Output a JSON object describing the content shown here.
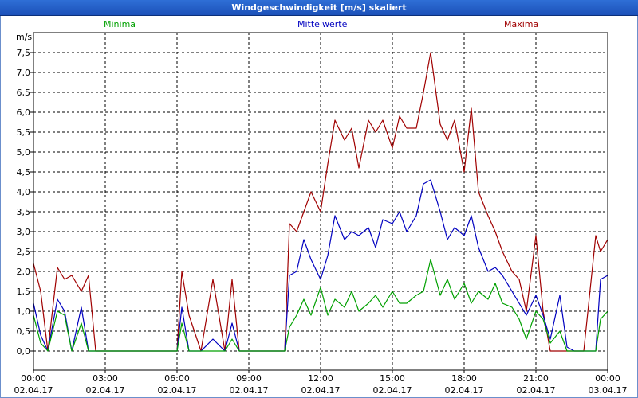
{
  "chart_data": {
    "type": "line",
    "title": "Windgeschwindigkeit [m/s] skaliert",
    "ylabel": "m/s",
    "ylim": [
      0,
      8
    ],
    "yticks": [
      "0,0",
      "0,5",
      "1,0",
      "1,5",
      "2,0",
      "2,5",
      "3,0",
      "3,5",
      "4,0",
      "4,5",
      "5,0",
      "5,5",
      "6,0",
      "6,5",
      "7,0",
      "7,5"
    ],
    "xlim": [
      0,
      24
    ],
    "xticks": [
      {
        "time": "00:00",
        "date": "02.04.17"
      },
      {
        "time": "03:00",
        "date": "02.04.17"
      },
      {
        "time": "06:00",
        "date": "02.04.17"
      },
      {
        "time": "09:00",
        "date": "02.04.17"
      },
      {
        "time": "12:00",
        "date": "02.04.17"
      },
      {
        "time": "15:00",
        "date": "02.04.17"
      },
      {
        "time": "18:00",
        "date": "02.04.17"
      },
      {
        "time": "21:00",
        "date": "02.04.17"
      },
      {
        "time": "00:00",
        "date": "03.04.17"
      }
    ],
    "grid": true,
    "series": [
      {
        "name": "Minima",
        "color": "#00a000",
        "x": [
          0.0,
          0.3,
          0.6,
          1.0,
          1.3,
          1.6,
          2.0,
          2.3,
          2.6,
          3.0,
          6.0,
          6.2,
          6.5,
          7.0,
          7.5,
          8.0,
          8.3,
          8.6,
          9.0,
          10.5,
          10.7,
          11.0,
          11.3,
          11.6,
          12.0,
          12.3,
          12.6,
          13.0,
          13.3,
          13.6,
          14.0,
          14.3,
          14.6,
          15.0,
          15.3,
          15.6,
          16.0,
          16.3,
          16.6,
          17.0,
          17.3,
          17.6,
          18.0,
          18.3,
          18.6,
          19.0,
          19.3,
          19.6,
          20.0,
          20.3,
          20.6,
          21.0,
          21.3,
          21.6,
          22.0,
          22.3,
          22.6,
          23.0,
          23.5,
          23.7,
          24.0
        ],
        "y": [
          0.9,
          0.2,
          0.0,
          1.0,
          0.9,
          0.0,
          0.7,
          0.0,
          0.0,
          0.0,
          0.0,
          0.7,
          0.0,
          0.0,
          0.0,
          0.0,
          0.3,
          0.0,
          0.0,
          0.0,
          0.6,
          0.9,
          1.3,
          0.9,
          1.6,
          0.9,
          1.3,
          1.1,
          1.5,
          1.0,
          1.2,
          1.4,
          1.1,
          1.5,
          1.2,
          1.2,
          1.4,
          1.5,
          2.3,
          1.4,
          1.8,
          1.3,
          1.7,
          1.2,
          1.5,
          1.3,
          1.7,
          1.2,
          1.1,
          0.8,
          0.3,
          1.0,
          0.8,
          0.2,
          0.5,
          0.0,
          0.0,
          0.0,
          0.0,
          0.8,
          1.0
        ]
      },
      {
        "name": "Mittelwerte",
        "color": "#0000c0",
        "x": [
          0.0,
          0.3,
          0.6,
          1.0,
          1.3,
          1.6,
          2.0,
          2.3,
          2.6,
          3.0,
          6.0,
          6.2,
          6.5,
          7.0,
          7.5,
          8.0,
          8.3,
          8.6,
          9.0,
          10.5,
          10.7,
          11.0,
          11.3,
          11.6,
          12.0,
          12.3,
          12.6,
          13.0,
          13.3,
          13.6,
          14.0,
          14.3,
          14.6,
          15.0,
          15.3,
          15.6,
          16.0,
          16.3,
          16.6,
          17.0,
          17.3,
          17.6,
          18.0,
          18.3,
          18.6,
          19.0,
          19.3,
          19.6,
          20.0,
          20.3,
          20.6,
          21.0,
          21.3,
          21.6,
          22.0,
          22.3,
          22.6,
          23.0,
          23.5,
          23.7,
          24.0
        ],
        "y": [
          1.2,
          0.4,
          0.0,
          1.3,
          1.0,
          0.0,
          1.1,
          0.0,
          0.0,
          0.0,
          0.0,
          1.1,
          0.0,
          0.0,
          0.3,
          0.0,
          0.7,
          0.0,
          0.0,
          0.0,
          1.9,
          2.0,
          2.8,
          2.3,
          1.8,
          2.4,
          3.4,
          2.8,
          3.0,
          2.9,
          3.1,
          2.6,
          3.3,
          3.2,
          3.5,
          3.0,
          3.4,
          4.2,
          4.3,
          3.5,
          2.8,
          3.1,
          2.9,
          3.4,
          2.6,
          2.0,
          2.1,
          1.9,
          1.5,
          1.2,
          0.9,
          1.4,
          0.9,
          0.3,
          1.4,
          0.1,
          0.0,
          0.0,
          0.0,
          1.8,
          1.9
        ]
      },
      {
        "name": "Maxima",
        "color": "#a00000",
        "x": [
          0.0,
          0.3,
          0.6,
          1.0,
          1.3,
          1.6,
          2.0,
          2.3,
          2.6,
          3.0,
          6.0,
          6.2,
          6.5,
          7.0,
          7.5,
          8.0,
          8.3,
          8.6,
          9.0,
          10.5,
          10.7,
          11.0,
          11.3,
          11.6,
          12.0,
          12.3,
          12.6,
          13.0,
          13.3,
          13.6,
          14.0,
          14.3,
          14.6,
          15.0,
          15.3,
          15.6,
          16.0,
          16.3,
          16.6,
          17.0,
          17.3,
          17.6,
          18.0,
          18.3,
          18.6,
          19.0,
          19.3,
          19.6,
          20.0,
          20.3,
          20.6,
          21.0,
          21.3,
          21.6,
          22.0,
          22.3,
          22.6,
          23.0,
          23.5,
          23.7,
          24.0
        ],
        "y": [
          2.2,
          1.5,
          0.0,
          2.1,
          1.8,
          1.9,
          1.5,
          1.9,
          0.0,
          0.0,
          0.0,
          2.0,
          0.9,
          0.0,
          1.8,
          0.0,
          1.8,
          0.0,
          0.0,
          0.0,
          3.2,
          3.0,
          3.5,
          4.0,
          3.5,
          4.7,
          5.8,
          5.3,
          5.6,
          4.6,
          5.8,
          5.5,
          5.8,
          5.1,
          5.9,
          5.6,
          5.6,
          6.5,
          7.5,
          5.7,
          5.3,
          5.8,
          4.5,
          6.1,
          4.0,
          3.4,
          3.0,
          2.5,
          2.0,
          1.8,
          1.0,
          2.9,
          1.0,
          0.0,
          0.0,
          0.0,
          0.0,
          0.0,
          2.9,
          2.5,
          2.8
        ]
      }
    ]
  }
}
